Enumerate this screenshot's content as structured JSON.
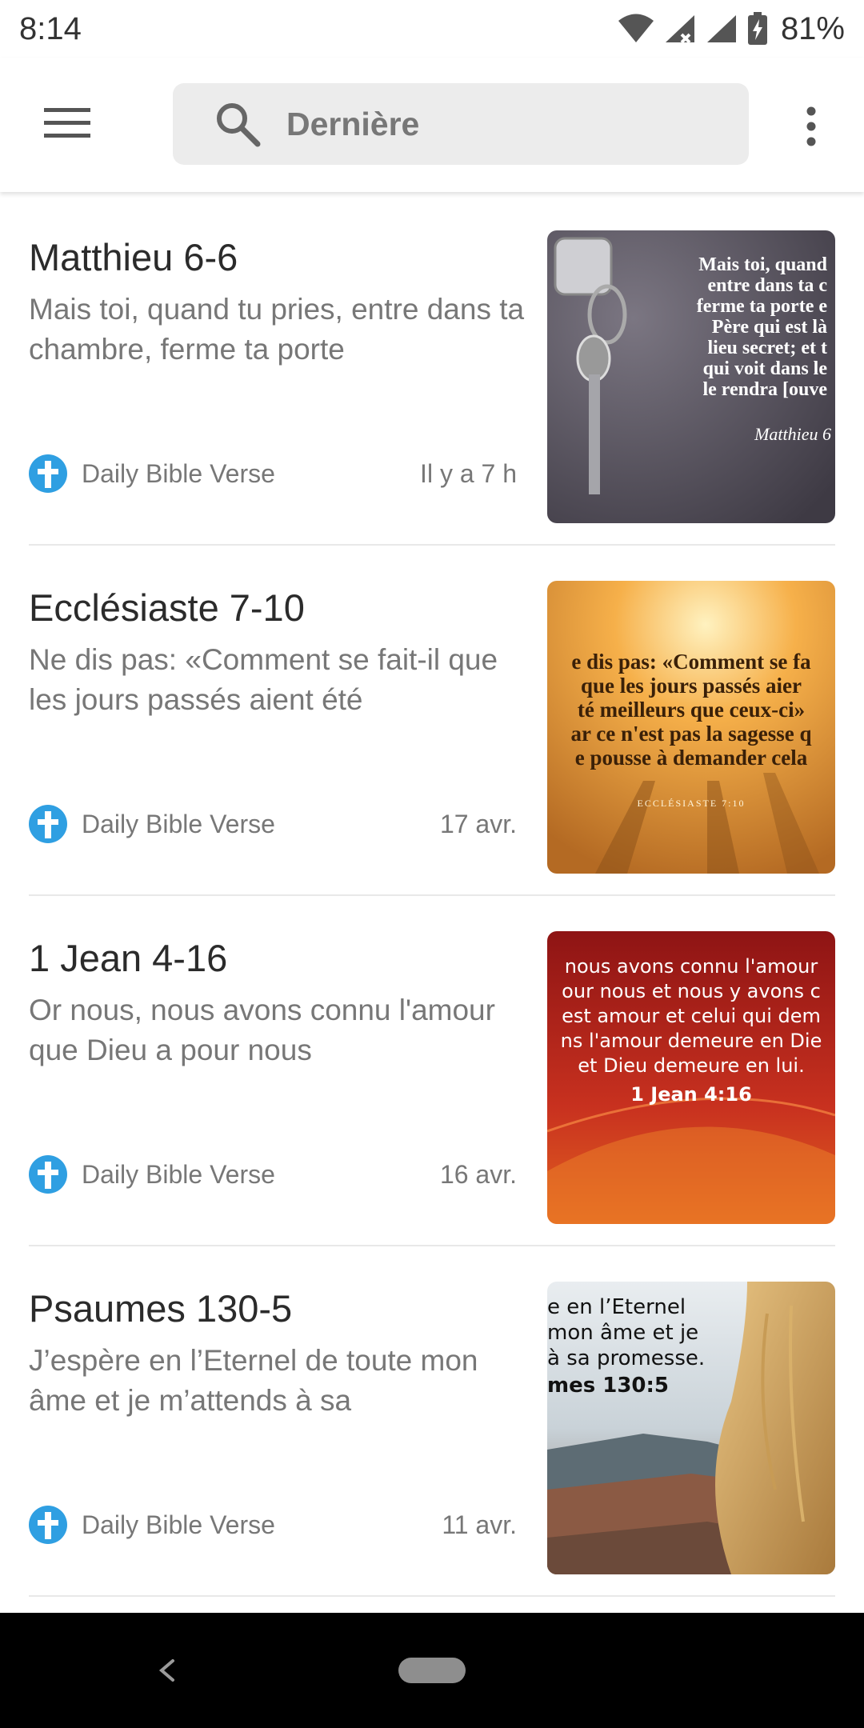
{
  "status_bar": {
    "time": "8:14",
    "battery_percent": "81%",
    "icons": [
      "wifi-icon",
      "cell-signal-icon",
      "cell-signal-icon",
      "battery-charging-icon"
    ]
  },
  "top_bar": {
    "menu_icon": "hamburger-menu-icon",
    "search_icon": "search-icon",
    "search_text": "Dernière",
    "overflow_icon": "more-vertical-icon"
  },
  "colors": {
    "source_icon": "#2f9fe2",
    "title_text": "#2b2b2b",
    "secondary_text": "#777777"
  },
  "articles": [
    {
      "title": "Matthieu 6-6",
      "snippet": "Mais toi, quand tu pries, entre dans ta chambre, ferme ta porte",
      "source": "Daily Bible Verse",
      "date": "Il y a 7 h",
      "thumb_lines": [
        "Mais toi, quand",
        "entre dans ta c",
        "ferme ta porte e",
        "Père qui est là",
        "lieu secret; et t",
        "qui voit dans le",
        "le rendra [ouve"
      ],
      "thumb_caption": "Matthieu 6"
    },
    {
      "title": "Ecclésiaste 7-10",
      "snippet": "Ne dis pas: «Comment se fait-il que les jours passés aient été",
      "source": "Daily Bible Verse",
      "date": "17 avr.",
      "thumb_lines": [
        "e dis pas: «Comment se fa",
        "que les jours passés aier",
        "té meilleurs que ceux-ci»",
        "ar ce n'est pas la sagesse q",
        "e pousse à demander cela"
      ],
      "thumb_caption": "ECCLÉSIASTE 7:10"
    },
    {
      "title": "1 Jean 4-16",
      "snippet": "Or nous, nous avons connu l'amour que Dieu a pour nous",
      "source": "Daily Bible Verse",
      "date": "16 avr.",
      "thumb_lines": [
        "nous avons connu l'amour",
        "our nous et nous y avons c",
        "est amour et celui qui dem",
        "ns l'amour demeure en Die",
        "et Dieu demeure en lui."
      ],
      "thumb_caption": "1 Jean 4:16"
    },
    {
      "title": "Psaumes 130-5",
      "snippet": "J’espère en l’Eternel de toute mon âme et je m’attends à sa",
      "source": "Daily Bible Verse",
      "date": "11 avr.",
      "thumb_lines": [
        "e en l’Eternel",
        "mon âme et je",
        "à sa promesse."
      ],
      "thumb_caption": "mes 130:5"
    }
  ],
  "nav_bar": {
    "back_icon": "back-chevron-icon",
    "home_icon": "home-pill-icon"
  }
}
